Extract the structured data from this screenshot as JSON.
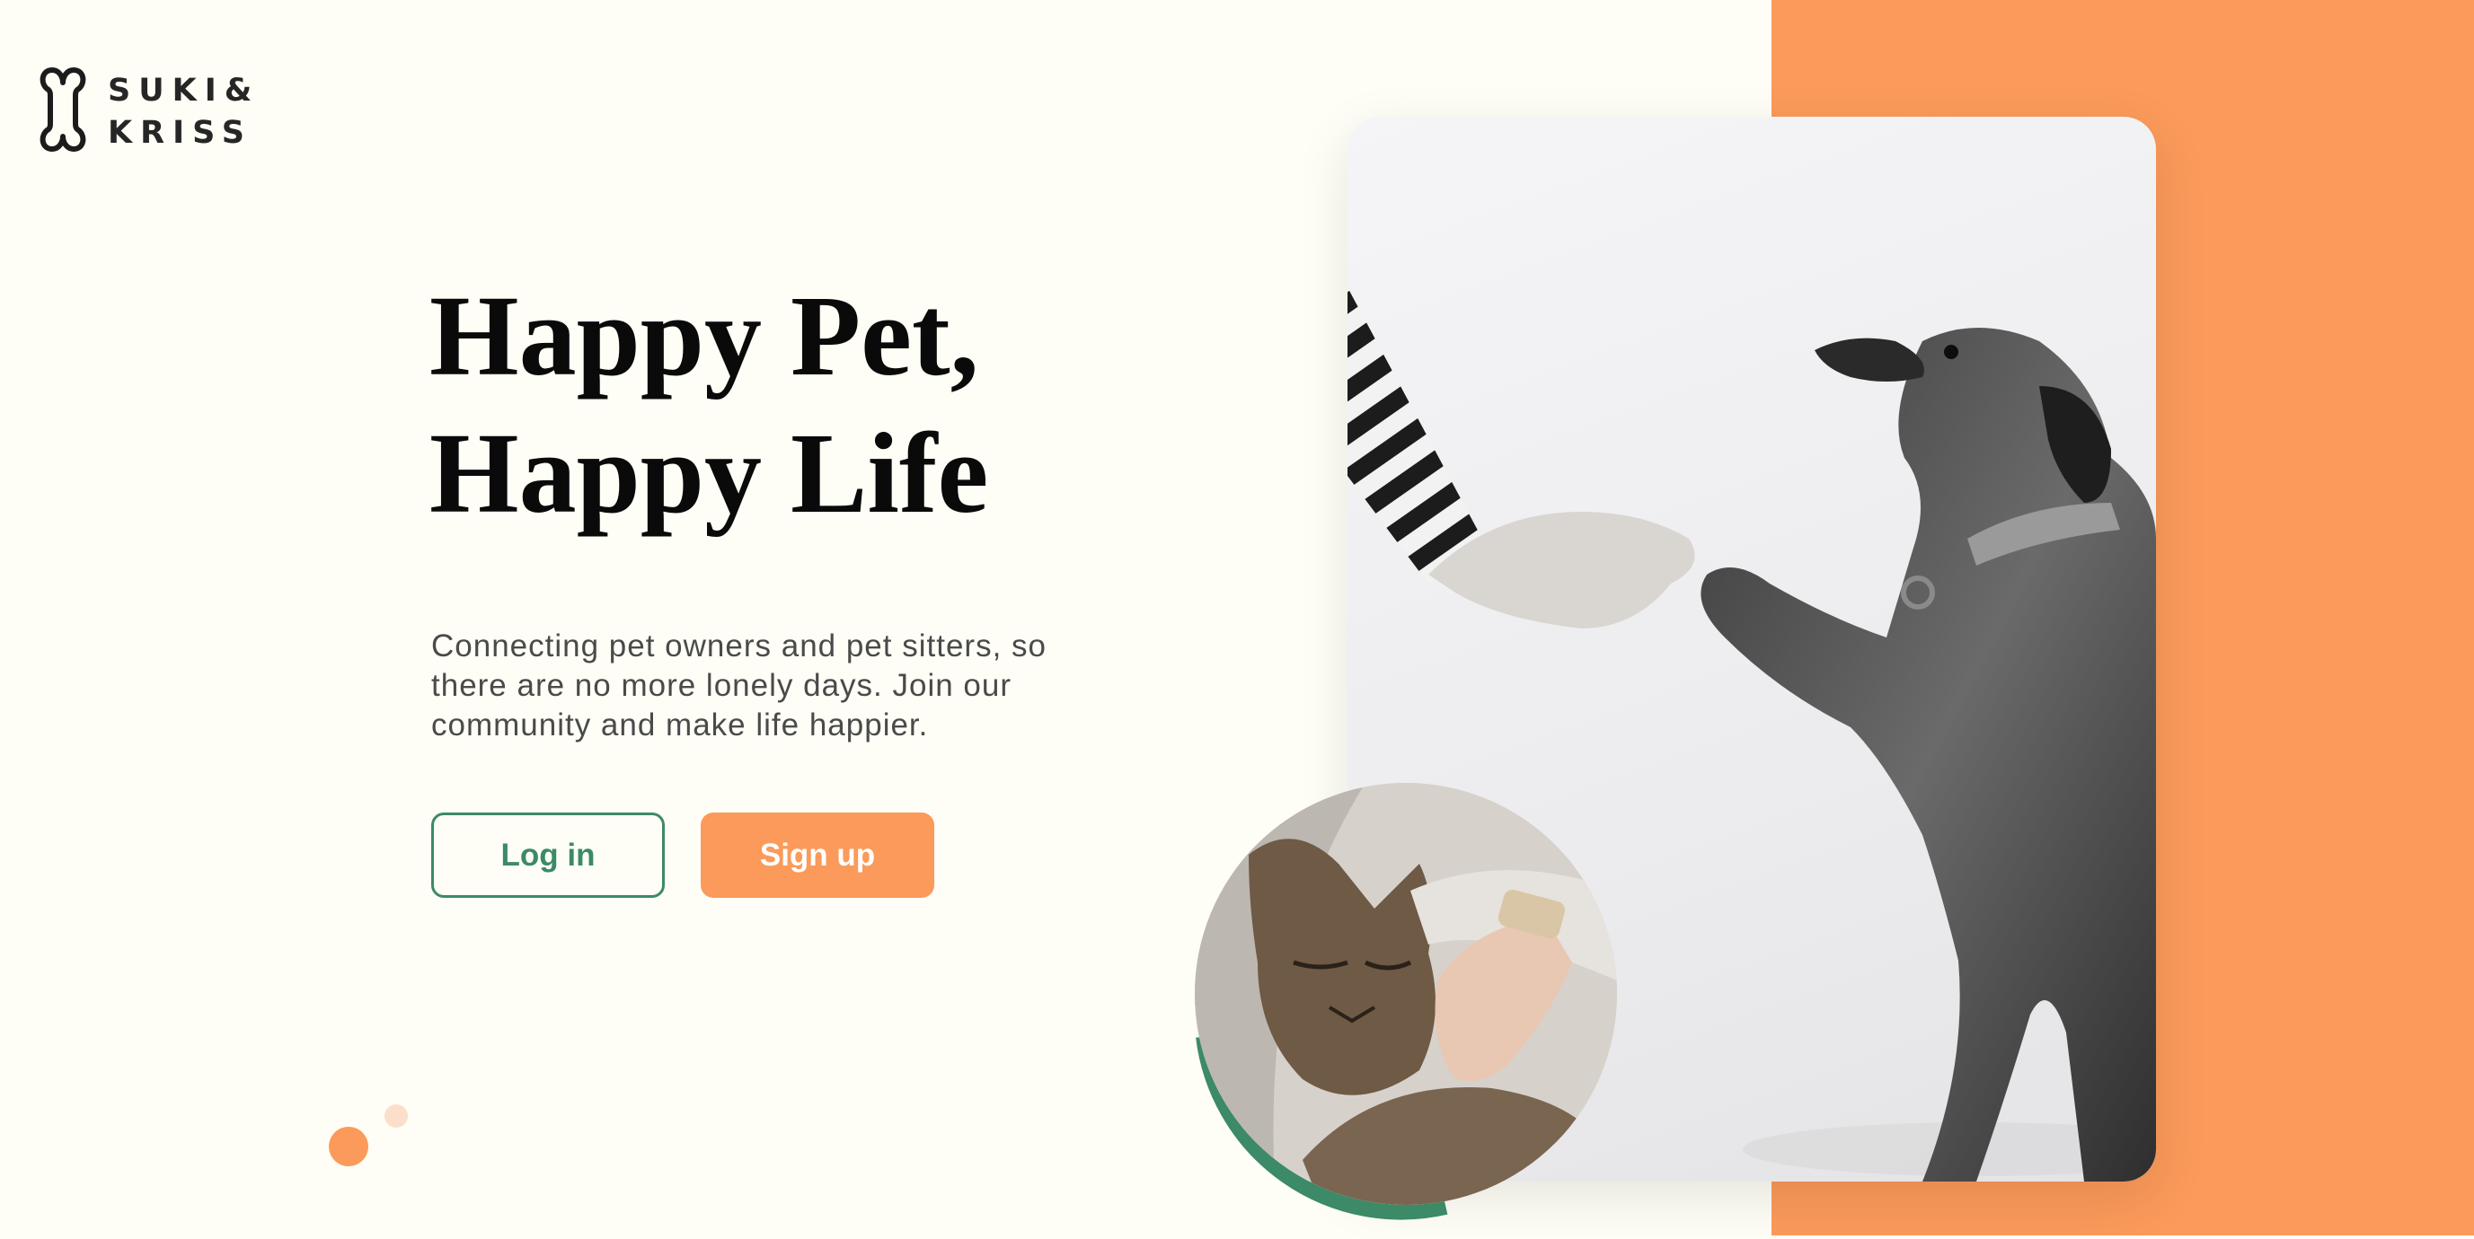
{
  "brand": {
    "logo_icon": "bone-icon",
    "name_line1": "SUKI&",
    "name_line2": "KRISS"
  },
  "hero": {
    "title_line1": "Happy Pet,",
    "title_line2": "Happy Life",
    "description": "Connecting pet owners and pet sitters, so there are no more lonely days. Join our community and make life happier."
  },
  "actions": {
    "login_label": "Log in",
    "signup_label": "Sign up"
  },
  "images": {
    "main_photo": "dog-paw-handshake-photo",
    "inset_photo": "cat-cuddle-photo"
  },
  "colors": {
    "background": "#fffef6",
    "accent_orange": "#fb9a5a",
    "accent_green": "#3c8a67",
    "text_dark": "#0a0a0a",
    "text_body": "#4a4a4a"
  }
}
